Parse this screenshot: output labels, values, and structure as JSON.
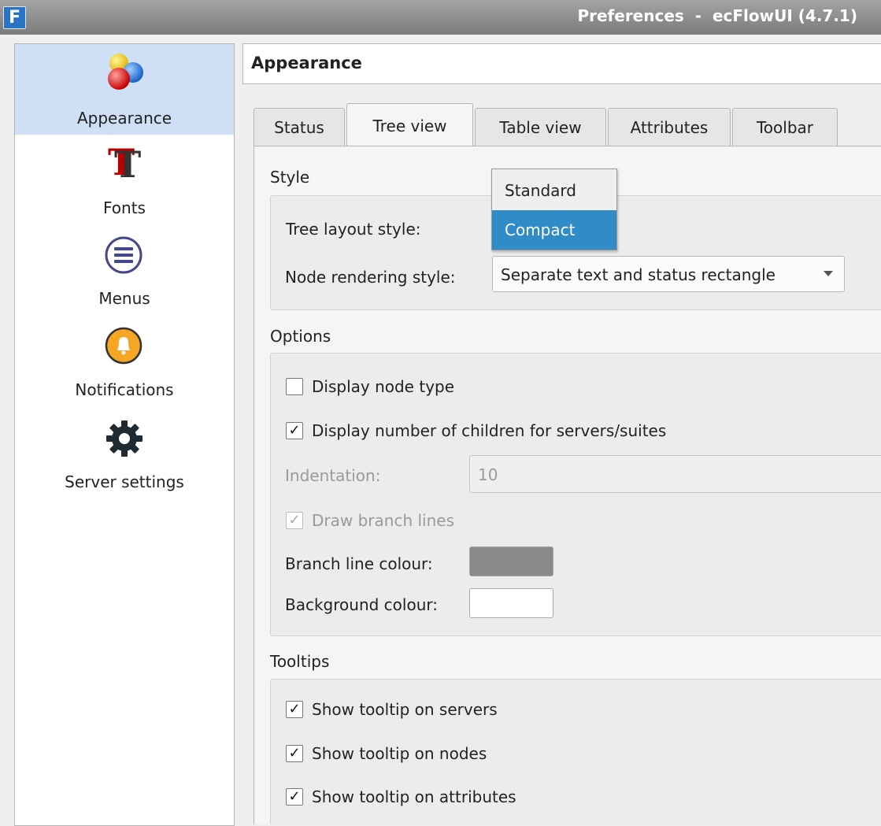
{
  "window": {
    "title": "Preferences  -  ecFlowUI (4.7.1)",
    "app_icon_letter": "F"
  },
  "sidebar": {
    "items": [
      {
        "label": "Appearance",
        "icon": "balls-icon",
        "selected": true
      },
      {
        "label": "Fonts",
        "icon": "font-icon",
        "selected": false
      },
      {
        "label": "Menus",
        "icon": "menu-icon",
        "selected": false
      },
      {
        "label": "Notifications",
        "icon": "bell-icon",
        "selected": false
      },
      {
        "label": "Server settings",
        "icon": "gear-icon",
        "selected": false
      }
    ]
  },
  "main": {
    "title": "Appearance",
    "tabs": [
      {
        "label": "Status",
        "active": false
      },
      {
        "label": "Tree view",
        "active": true
      },
      {
        "label": "Table view",
        "active": false
      },
      {
        "label": "Attributes",
        "active": false
      },
      {
        "label": "Toolbar",
        "active": false
      }
    ]
  },
  "style": {
    "title": "Style",
    "tree_layout_label": "Tree layout style:",
    "tree_layout_options": [
      "Standard",
      "Compact"
    ],
    "tree_layout_highlighted": "Compact",
    "node_rendering_label": "Node rendering style:",
    "node_rendering_value": "Separate text and status rectangle"
  },
  "options": {
    "title": "Options",
    "display_node_type": {
      "label": "Display node type",
      "checked": false
    },
    "display_children": {
      "label": "Display number of children for servers/suites",
      "checked": true
    },
    "indentation_label": "Indentation:",
    "indentation_value": "10",
    "draw_branch_lines": {
      "label": "Draw branch lines",
      "checked": true,
      "disabled": true
    },
    "branch_colour_label": "Branch line colour:",
    "branch_colour": "#8a8a8a",
    "background_colour_label": "Background colour:",
    "background_colour": "#ffffff"
  },
  "tooltips": {
    "title": "Tooltips",
    "servers": {
      "label": "Show tooltip on servers",
      "checked": true
    },
    "nodes": {
      "label": "Show tooltip on nodes",
      "checked": true
    },
    "attributes": {
      "label": "Show tooltip on attributes",
      "checked": true
    }
  },
  "check_mark": "✓",
  "colors": {
    "selection": "#308cc6",
    "sidebar_selected": "#cfdff6"
  }
}
